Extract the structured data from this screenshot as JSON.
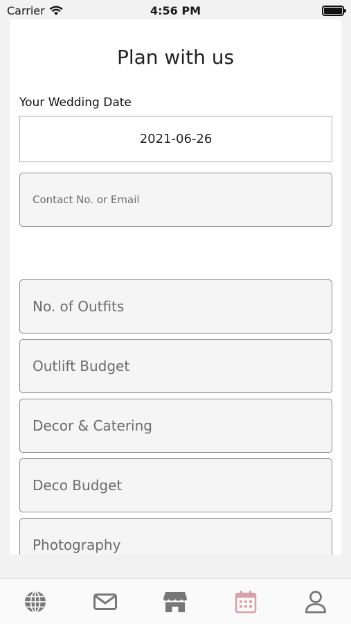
{
  "status_bar": {
    "carrier": "Carrier",
    "time": "4:56 PM"
  },
  "page": {
    "title": "Plan with us",
    "wedding_date_label": "Your Wedding Date",
    "wedding_date_value": "2021-06-26",
    "fields": {
      "contact": {
        "placeholder": "Contact No. or Email",
        "value": ""
      },
      "outfits": {
        "placeholder": "No. of Outfits",
        "value": ""
      },
      "outfit_budget": {
        "placeholder": "Outlift Budget",
        "value": ""
      },
      "decor_catering": {
        "placeholder": "Decor & Catering",
        "value": ""
      },
      "deco_budget": {
        "placeholder": "Deco Budget",
        "value": ""
      },
      "photography": {
        "placeholder": "Photography",
        "value": ""
      }
    }
  },
  "tab_bar": {
    "items": [
      {
        "icon": "globe-icon"
      },
      {
        "icon": "mail-icon"
      },
      {
        "icon": "store-icon"
      },
      {
        "icon": "calendar-icon",
        "active": true
      },
      {
        "icon": "user-icon"
      }
    ],
    "active_color": "#d8a0a8",
    "inactive_color": "#777777"
  }
}
